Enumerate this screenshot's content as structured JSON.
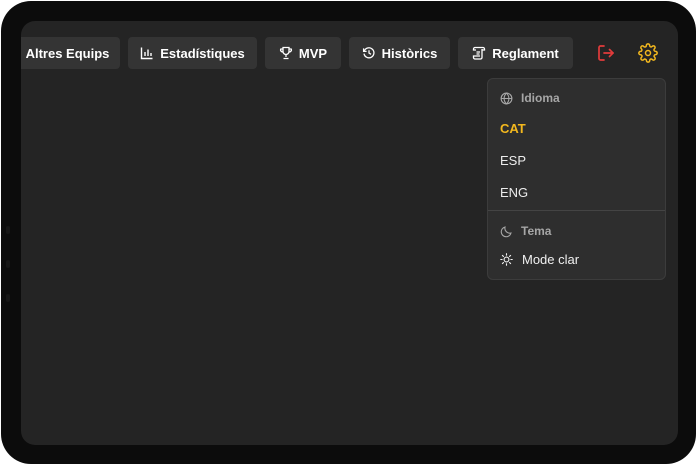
{
  "nav": {
    "items": [
      {
        "label": "Altres Equips",
        "icon": "none"
      },
      {
        "label": "Estadístiques",
        "icon": "bar-chart-icon"
      },
      {
        "label": "MVP",
        "icon": "trophy-icon"
      },
      {
        "label": "Històrics",
        "icon": "history-icon"
      },
      {
        "label": "Reglament",
        "icon": "scroll-icon"
      }
    ],
    "logout_icon": "logout-icon",
    "settings_icon": "gear-icon"
  },
  "settings_menu": {
    "language_header": "Idioma",
    "languages": [
      {
        "label": "CAT",
        "selected": true
      },
      {
        "label": "ESP",
        "selected": false
      },
      {
        "label": "ENG",
        "selected": false
      }
    ],
    "theme_header": "Tema",
    "theme_toggle_label": "Mode clar"
  },
  "colors": {
    "accent": "#f3b81e",
    "logout": "#e23b3b",
    "background": "#242424",
    "button": "#343434"
  }
}
